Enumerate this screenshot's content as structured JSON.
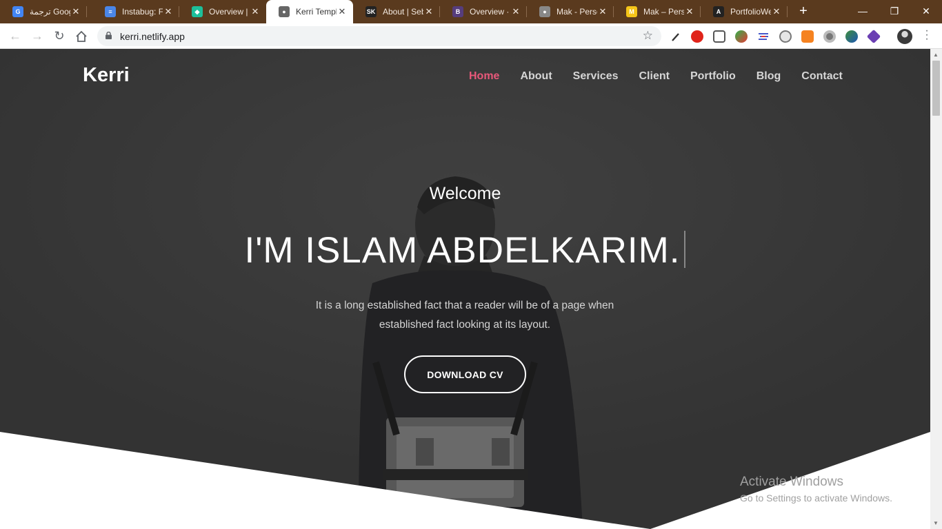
{
  "browser": {
    "tabs": [
      {
        "title": "ترجمة Google",
        "fav_text": "G",
        "fav_color": "#4285f4"
      },
      {
        "title": "Instabug: Fr",
        "fav_text": "≡",
        "fav_color": "#4a86e8"
      },
      {
        "title": "Overview | I",
        "fav_text": "◆",
        "fav_color": "#1dbf9a"
      },
      {
        "title": "Kerri Templ",
        "fav_text": "●",
        "fav_color": "#666666"
      },
      {
        "title": "About | Seb",
        "fav_text": "SK",
        "fav_color": "#222222"
      },
      {
        "title": "Overview · I",
        "fav_text": "B",
        "fav_color": "#563d7c"
      },
      {
        "title": "Mak - Perso",
        "fav_text": "●",
        "fav_color": "#888888"
      },
      {
        "title": "Mak – Perso",
        "fav_text": "M",
        "fav_color": "#f5c518"
      },
      {
        "title": "PortfolioWe",
        "fav_text": "A",
        "fav_color": "#222222"
      }
    ],
    "active_tab": 3,
    "url": "kerri.netlify.app",
    "window_controls": {
      "minimize": "—",
      "restore": "❐",
      "close": "✕"
    }
  },
  "site": {
    "brand": "Kerri",
    "nav": [
      "Home",
      "About",
      "Services",
      "Client",
      "Portfolio",
      "Blog",
      "Contact"
    ],
    "active_nav": "Home",
    "welcome": "Welcome",
    "headline": "I'M ISLAM ABDELKARIM.",
    "description": "It is a long established fact that a reader will be of a page when established fact looking at its layout.",
    "cta": "DOWNLOAD CV"
  },
  "os_overlay": {
    "line1": "Activate Windows",
    "line2": "Go to Settings to activate Windows."
  },
  "colors": {
    "accent": "#e8587a",
    "hero_bg": "#3c3c3c",
    "tabbar_bg": "#5a3a1e"
  }
}
